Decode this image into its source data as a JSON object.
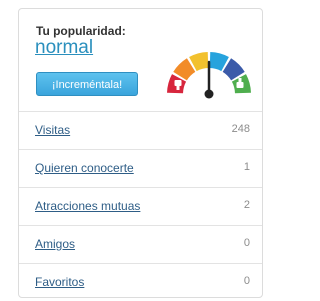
{
  "popularity": {
    "title": "Tu popularidad:",
    "level": "normal",
    "level_fraction": 0.5,
    "button_label": "¡Increméntala!",
    "gauge_colors": [
      "#d7263d",
      "#f28c28",
      "#f2c12e",
      "#27a3dd",
      "#3b5ba9",
      "#4fae4e"
    ],
    "gauge_icons": [
      "thumbs-down-icon",
      "thumbs-up-icon"
    ]
  },
  "stats": [
    {
      "label": "Visitas",
      "count": "248"
    },
    {
      "label": "Quieren conocerte",
      "count": "1"
    },
    {
      "label": "Atracciones mutuas",
      "count": "2"
    },
    {
      "label": "Amigos",
      "count": "0"
    },
    {
      "label": "Favoritos",
      "count": "0"
    }
  ]
}
